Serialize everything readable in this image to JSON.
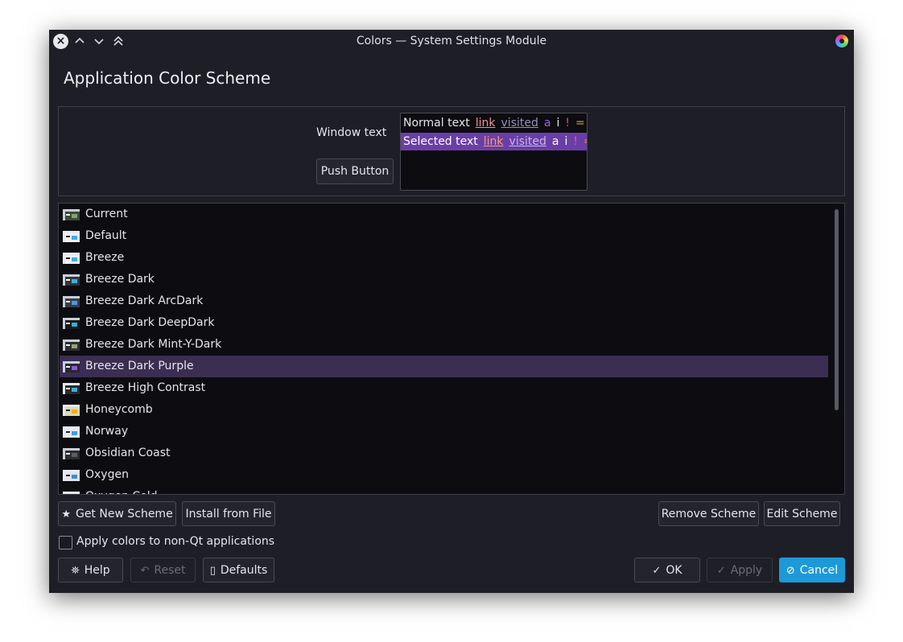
{
  "titlebar": {
    "title": "Colors — System Settings Module",
    "close_glyph": "×",
    "minimize_glyph": "⌃",
    "restore_glyph": "⌄",
    "maximize_glyph": "⌃"
  },
  "heading": "Application Color Scheme",
  "preview": {
    "window_text_label": "Window text",
    "push_button_label": "Push Button",
    "normal_row": [
      "Normal text",
      "link",
      "visited",
      "a",
      "i",
      "!",
      "=",
      "+"
    ],
    "selected_row": [
      "Selected text",
      "link",
      "visited",
      "a",
      "i",
      "!",
      "=",
      "+"
    ],
    "colors": {
      "normal_text": "#e6e6ea",
      "link": "#f0909a",
      "visited": "#9a8fb8",
      "active": "#9b67d6",
      "inactive": "#e6e6ea",
      "negative": "#e84a5f",
      "neutral": "#f29c35",
      "positive": "#3fc56a",
      "selection": "#6a3ea8"
    }
  },
  "schemes": [
    {
      "name": "Current",
      "swatch": [
        "#c8cfd6",
        "#3a4a3a",
        "#8aa070"
      ],
      "selected": false
    },
    {
      "name": "Default",
      "swatch": [
        "#e8eaee",
        "#eff0f1",
        "#3daee9"
      ],
      "selected": false
    },
    {
      "name": "Breeze",
      "swatch": [
        "#e8eaee",
        "#eff0f1",
        "#3daee9"
      ],
      "selected": false
    },
    {
      "name": "Breeze Dark",
      "swatch": [
        "#c8cfd6",
        "#31363b",
        "#3daee9"
      ],
      "selected": false
    },
    {
      "name": "Breeze Dark ArcDark",
      "swatch": [
        "#c8cfd6",
        "#383c4a",
        "#5294e2"
      ],
      "selected": false
    },
    {
      "name": "Breeze Dark DeepDark",
      "swatch": [
        "#c8cfd6",
        "#1a1a1a",
        "#2fb3e0"
      ],
      "selected": false
    },
    {
      "name": "Breeze Dark Mint-Y-Dark",
      "swatch": [
        "#c8cfd6",
        "#2f2f2f",
        "#8fa876"
      ],
      "selected": false
    },
    {
      "name": "Breeze Dark Purple",
      "swatch": [
        "#c8cfd6",
        "#2a2535",
        "#8a5cd0"
      ],
      "selected": true
    },
    {
      "name": "Breeze High Contrast",
      "swatch": [
        "#e8eaee",
        "#2a2a2a",
        "#3daee9"
      ],
      "selected": false
    },
    {
      "name": "Honeycomb",
      "swatch": [
        "#e8eaee",
        "#e0d8b0",
        "#f0b000"
      ],
      "selected": false
    },
    {
      "name": "Norway",
      "swatch": [
        "#e8eaee",
        "#e6ecf2",
        "#3aa0e0"
      ],
      "selected": false
    },
    {
      "name": "Obsidian Coast",
      "swatch": [
        "#c8cfd6",
        "#2c2c2c",
        "#556070"
      ],
      "selected": false
    },
    {
      "name": "Oxygen",
      "swatch": [
        "#e8eaee",
        "#e0e4ea",
        "#3a8ee0"
      ],
      "selected": false
    },
    {
      "name": "Oxygen Cold",
      "swatch": [
        "#e8eaee",
        "#dde6f0",
        "#4a9ae8"
      ],
      "selected": false
    }
  ],
  "actions": {
    "get_new_scheme": "Get New Scheme",
    "install_from_file": "Install from File",
    "remove_scheme": "Remove Scheme",
    "edit_scheme": "Edit Scheme"
  },
  "apply_non_qt": {
    "label": "Apply colors to non-Qt applications",
    "checked": false
  },
  "footer": {
    "help": "Help",
    "reset": "Reset",
    "defaults": "Defaults",
    "ok": "OK",
    "apply": "Apply",
    "cancel": "Cancel"
  },
  "icons": {
    "star": "★",
    "help": "⛯",
    "reset": "↶",
    "defaults": "▯",
    "ok": "✓",
    "apply": "✓",
    "cancel": "⊘"
  },
  "theme": {
    "window_bg": "#1e1e26",
    "view_bg": "#0c0c11",
    "accent": "#1d99d8",
    "selection": "#3a2e52"
  }
}
